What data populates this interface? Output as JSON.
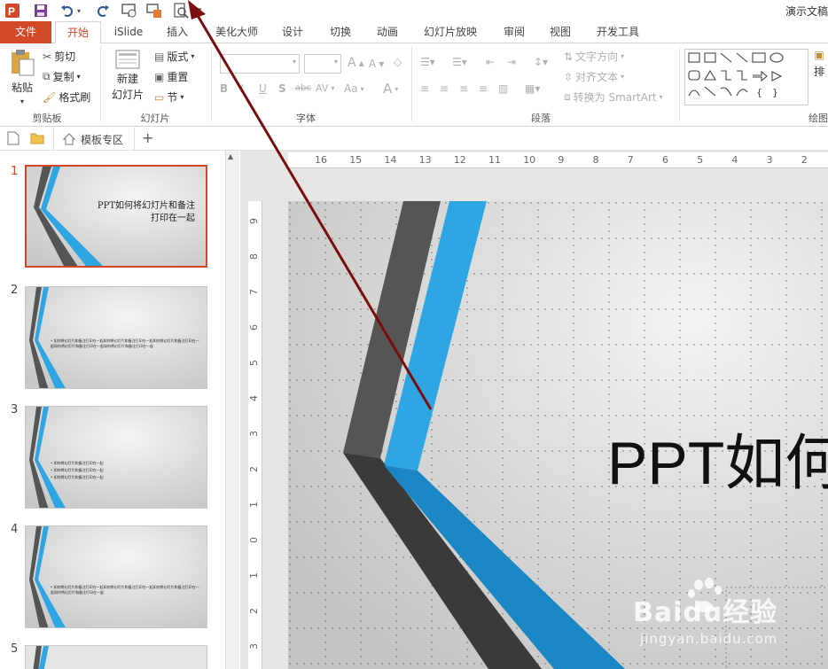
{
  "window": {
    "title": "演示文稿",
    "accent_color": "#d24726"
  },
  "quick_access": {
    "icons": [
      "powerpoint-logo-icon",
      "save-icon",
      "undo-icon",
      "undo-dropdown-icon",
      "redo-icon",
      "from-start-icon",
      "present-online-icon",
      "print-preview-icon",
      "customize-qat-icon"
    ]
  },
  "tabs": [
    {
      "label": "文件",
      "type": "file"
    },
    {
      "label": "开始",
      "type": "active"
    },
    {
      "label": "iSlide"
    },
    {
      "label": "插入"
    },
    {
      "label": "美化大师"
    },
    {
      "label": "设计"
    },
    {
      "label": "切换"
    },
    {
      "label": "动画"
    },
    {
      "label": "幻灯片放映"
    },
    {
      "label": "审阅"
    },
    {
      "label": "视图"
    },
    {
      "label": "开发工具"
    }
  ],
  "ribbon": {
    "clipboard": {
      "label": "剪贴板",
      "paste": "粘贴",
      "cut": "剪切",
      "copy": "复制",
      "format_painter": "格式刷"
    },
    "slides": {
      "label": "幻灯片",
      "new_slide_line1": "新建",
      "new_slide_line2": "幻灯片",
      "layout": "版式",
      "reset": "重置",
      "section": "节"
    },
    "font": {
      "label": "字体",
      "grow": "A",
      "shrink": "A",
      "bold": "B",
      "italic": "I",
      "underline": "U",
      "shadow": "S",
      "strike": "abc",
      "spacing": "AV",
      "case": "Aa",
      "color": "A"
    },
    "paragraph": {
      "label": "段落",
      "text_direction": "文字方向",
      "align_text": "对齐文本",
      "smartart": "转换为 SmartArt"
    },
    "drawing": {
      "label": "绘图",
      "arrange": "排"
    }
  },
  "doc_tabs": {
    "template_zone": "模板专区",
    "add": "+"
  },
  "slides": [
    {
      "number": "1",
      "title_line1": "PPT如何将幻灯片和备注",
      "title_line2": "打印在一起",
      "selected": true
    },
    {
      "number": "2",
      "body": "• 如何将幻灯片和备注打印在一起如何将幻灯片和备注打印在一起如何将幻灯片和备注打印在一起如何将幻灯片和备注打印在一起如何将幻灯片和备注打印在一起"
    },
    {
      "number": "3",
      "bullets": [
        "• 如何将幻灯片和备注打印在一起",
        "• 如何将幻灯片和备注打印在一起",
        "• 如何将幻灯片和备注打印在一起"
      ]
    },
    {
      "number": "4",
      "body": "• 如何将幻灯片和备注打印在一起如何将幻灯片和备注打印在一起如何将幻灯片和备注打印在一起如何将幻灯片和备注打印在一起"
    },
    {
      "number": "5"
    }
  ],
  "rulers": {
    "horizontal": [
      "16",
      "15",
      "14",
      "13",
      "12",
      "11",
      "10",
      "9",
      "8",
      "7",
      "6",
      "5",
      "4",
      "3",
      "2"
    ],
    "vertical": [
      "9",
      "8",
      "7",
      "6",
      "5",
      "4",
      "3",
      "2",
      "1",
      "0",
      "1",
      "2",
      "3"
    ]
  },
  "editor": {
    "title_text": "PPT如何"
  },
  "watermark": {
    "logo": "Baidu经验",
    "url": "jingyan.baidu.com"
  },
  "annotation": {
    "arrow_color": "#7a0e0e"
  }
}
